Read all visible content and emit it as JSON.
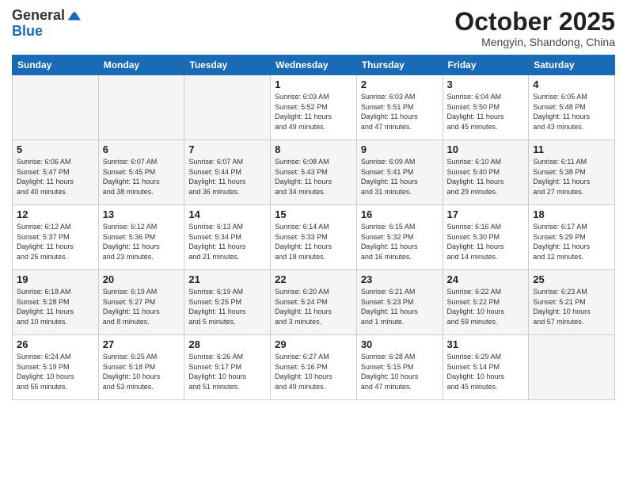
{
  "header": {
    "logo_line1": "General",
    "logo_line2": "Blue",
    "month": "October 2025",
    "location": "Mengyin, Shandong, China"
  },
  "weekdays": [
    "Sunday",
    "Monday",
    "Tuesday",
    "Wednesday",
    "Thursday",
    "Friday",
    "Saturday"
  ],
  "weeks": [
    [
      {
        "day": "",
        "info": ""
      },
      {
        "day": "",
        "info": ""
      },
      {
        "day": "",
        "info": ""
      },
      {
        "day": "1",
        "info": "Sunrise: 6:03 AM\nSunset: 5:52 PM\nDaylight: 11 hours\nand 49 minutes."
      },
      {
        "day": "2",
        "info": "Sunrise: 6:03 AM\nSunset: 5:51 PM\nDaylight: 11 hours\nand 47 minutes."
      },
      {
        "day": "3",
        "info": "Sunrise: 6:04 AM\nSunset: 5:50 PM\nDaylight: 11 hours\nand 45 minutes."
      },
      {
        "day": "4",
        "info": "Sunrise: 6:05 AM\nSunset: 5:48 PM\nDaylight: 11 hours\nand 43 minutes."
      }
    ],
    [
      {
        "day": "5",
        "info": "Sunrise: 6:06 AM\nSunset: 5:47 PM\nDaylight: 11 hours\nand 40 minutes."
      },
      {
        "day": "6",
        "info": "Sunrise: 6:07 AM\nSunset: 5:45 PM\nDaylight: 11 hours\nand 38 minutes."
      },
      {
        "day": "7",
        "info": "Sunrise: 6:07 AM\nSunset: 5:44 PM\nDaylight: 11 hours\nand 36 minutes."
      },
      {
        "day": "8",
        "info": "Sunrise: 6:08 AM\nSunset: 5:43 PM\nDaylight: 11 hours\nand 34 minutes."
      },
      {
        "day": "9",
        "info": "Sunrise: 6:09 AM\nSunset: 5:41 PM\nDaylight: 11 hours\nand 31 minutes."
      },
      {
        "day": "10",
        "info": "Sunrise: 6:10 AM\nSunset: 5:40 PM\nDaylight: 11 hours\nand 29 minutes."
      },
      {
        "day": "11",
        "info": "Sunrise: 6:11 AM\nSunset: 5:38 PM\nDaylight: 11 hours\nand 27 minutes."
      }
    ],
    [
      {
        "day": "12",
        "info": "Sunrise: 6:12 AM\nSunset: 5:37 PM\nDaylight: 11 hours\nand 25 minutes."
      },
      {
        "day": "13",
        "info": "Sunrise: 6:12 AM\nSunset: 5:36 PM\nDaylight: 11 hours\nand 23 minutes."
      },
      {
        "day": "14",
        "info": "Sunrise: 6:13 AM\nSunset: 5:34 PM\nDaylight: 11 hours\nand 21 minutes."
      },
      {
        "day": "15",
        "info": "Sunrise: 6:14 AM\nSunset: 5:33 PM\nDaylight: 11 hours\nand 18 minutes."
      },
      {
        "day": "16",
        "info": "Sunrise: 6:15 AM\nSunset: 5:32 PM\nDaylight: 11 hours\nand 16 minutes."
      },
      {
        "day": "17",
        "info": "Sunrise: 6:16 AM\nSunset: 5:30 PM\nDaylight: 11 hours\nand 14 minutes."
      },
      {
        "day": "18",
        "info": "Sunrise: 6:17 AM\nSunset: 5:29 PM\nDaylight: 11 hours\nand 12 minutes."
      }
    ],
    [
      {
        "day": "19",
        "info": "Sunrise: 6:18 AM\nSunset: 5:28 PM\nDaylight: 11 hours\nand 10 minutes."
      },
      {
        "day": "20",
        "info": "Sunrise: 6:19 AM\nSunset: 5:27 PM\nDaylight: 11 hours\nand 8 minutes."
      },
      {
        "day": "21",
        "info": "Sunrise: 6:19 AM\nSunset: 5:25 PM\nDaylight: 11 hours\nand 5 minutes."
      },
      {
        "day": "22",
        "info": "Sunrise: 6:20 AM\nSunset: 5:24 PM\nDaylight: 11 hours\nand 3 minutes."
      },
      {
        "day": "23",
        "info": "Sunrise: 6:21 AM\nSunset: 5:23 PM\nDaylight: 11 hours\nand 1 minute."
      },
      {
        "day": "24",
        "info": "Sunrise: 6:22 AM\nSunset: 5:22 PM\nDaylight: 10 hours\nand 59 minutes."
      },
      {
        "day": "25",
        "info": "Sunrise: 6:23 AM\nSunset: 5:21 PM\nDaylight: 10 hours\nand 57 minutes."
      }
    ],
    [
      {
        "day": "26",
        "info": "Sunrise: 6:24 AM\nSunset: 5:19 PM\nDaylight: 10 hours\nand 55 minutes."
      },
      {
        "day": "27",
        "info": "Sunrise: 6:25 AM\nSunset: 5:18 PM\nDaylight: 10 hours\nand 53 minutes."
      },
      {
        "day": "28",
        "info": "Sunrise: 6:26 AM\nSunset: 5:17 PM\nDaylight: 10 hours\nand 51 minutes."
      },
      {
        "day": "29",
        "info": "Sunrise: 6:27 AM\nSunset: 5:16 PM\nDaylight: 10 hours\nand 49 minutes."
      },
      {
        "day": "30",
        "info": "Sunrise: 6:28 AM\nSunset: 5:15 PM\nDaylight: 10 hours\nand 47 minutes."
      },
      {
        "day": "31",
        "info": "Sunrise: 6:29 AM\nSunset: 5:14 PM\nDaylight: 10 hours\nand 45 minutes."
      },
      {
        "day": "",
        "info": ""
      }
    ]
  ]
}
